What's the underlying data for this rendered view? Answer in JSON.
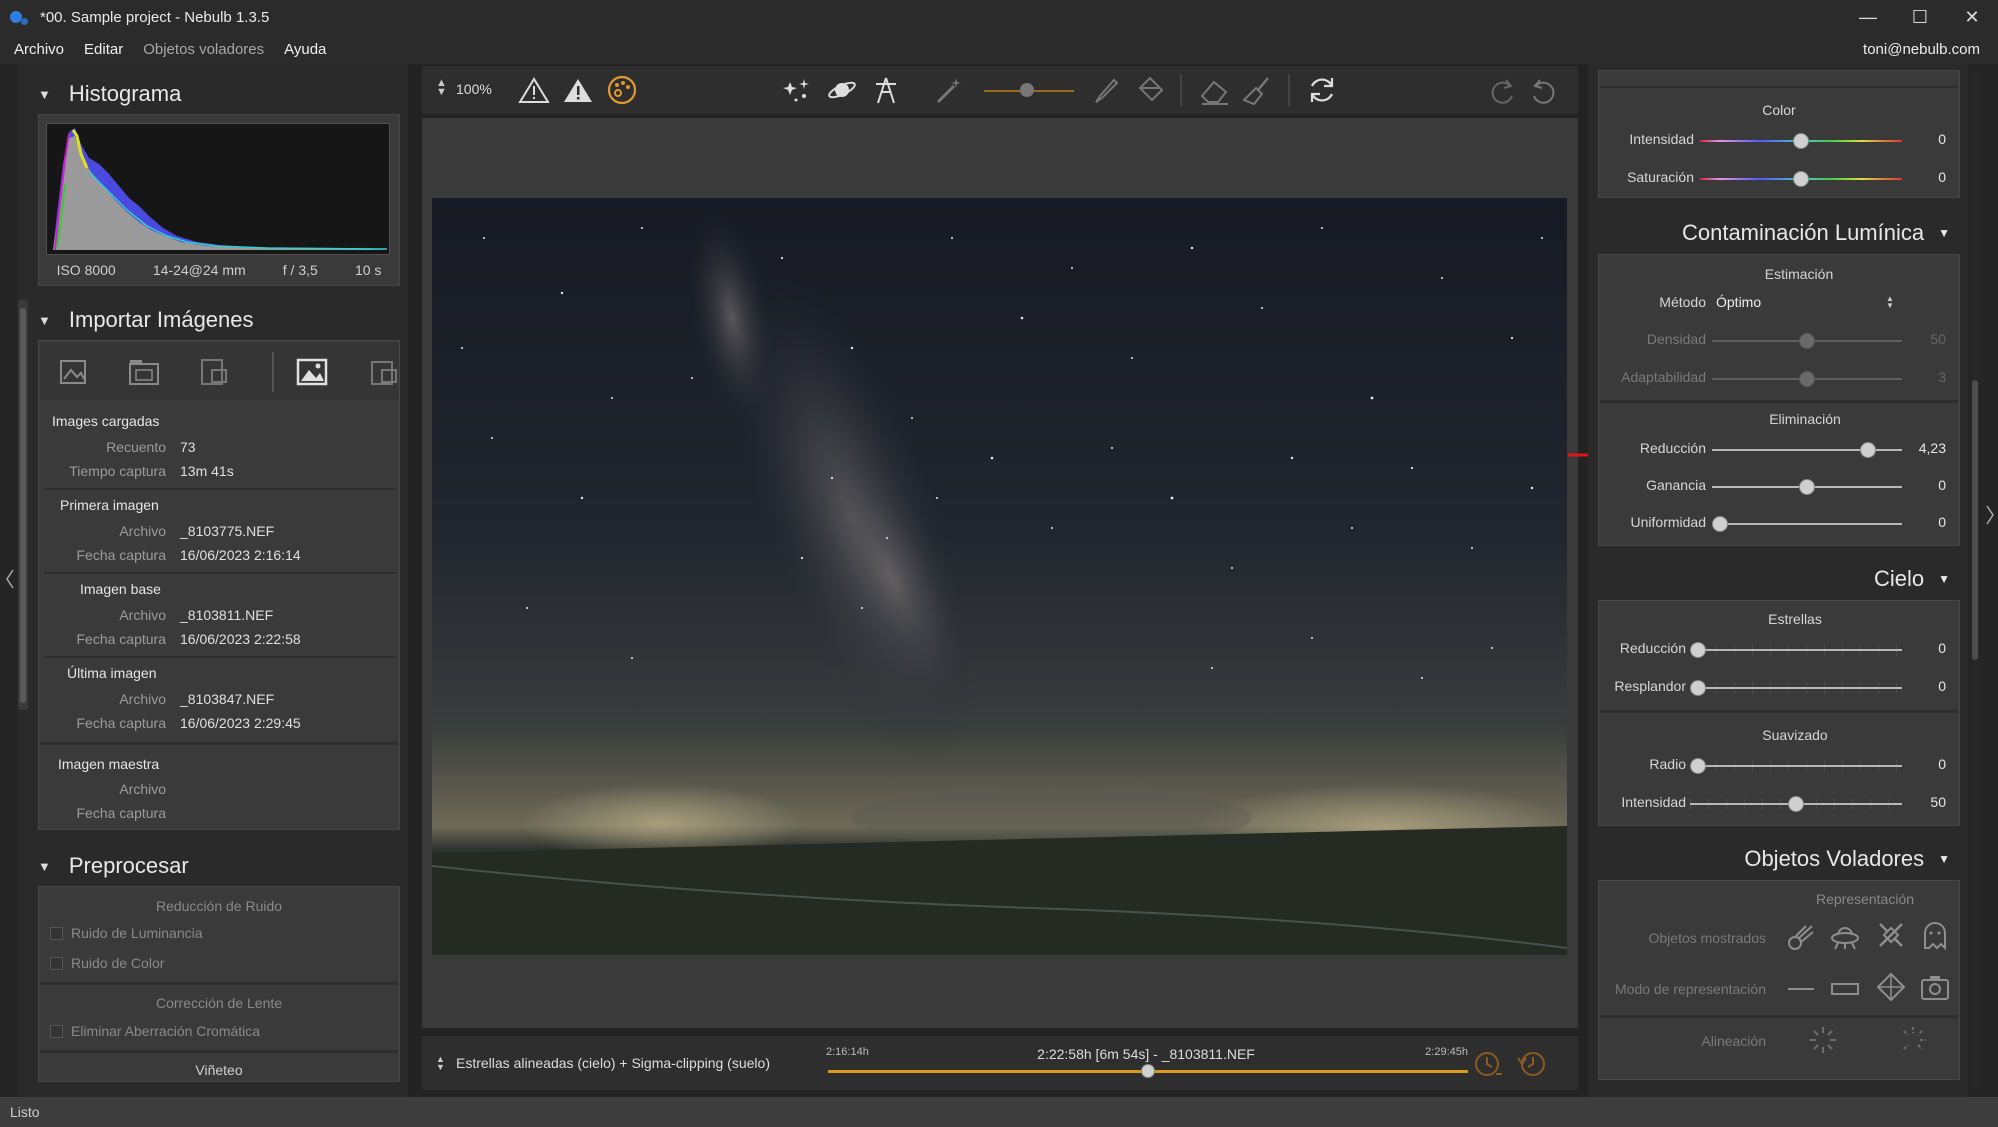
{
  "app": {
    "title": "*00. Sample project - Nebulb 1.3.5",
    "window_controls": {
      "minimize": "—",
      "maximize": "☐",
      "close": "✕"
    }
  },
  "menu": {
    "items": [
      "Archivo",
      "Editar",
      "Objetos voladores",
      "Ayuda"
    ],
    "user": "toni@nebulb.com"
  },
  "histogram": {
    "title": "Histograma",
    "iso": "ISO 8000",
    "lens": "14-24@24 mm",
    "aperture": "f / 3,5",
    "exposure": "10 s"
  },
  "import": {
    "title": "Importar Imágenes",
    "loaded": {
      "heading": "Images cargadas",
      "count_label": "Recuento",
      "count": "73",
      "time_label": "Tiempo captura",
      "time": "13m 41s"
    },
    "first": {
      "heading": "Primera imagen",
      "file_label": "Archivo",
      "file": "_8103775.NEF",
      "date_label": "Fecha captura",
      "date": "16/06/2023 2:16:14"
    },
    "base": {
      "heading": "Imagen base",
      "file_label": "Archivo",
      "file": "_8103811.NEF",
      "date_label": "Fecha captura",
      "date": "16/06/2023 2:22:58"
    },
    "last": {
      "heading": "Última imagen",
      "file_label": "Archivo",
      "file": "_8103847.NEF",
      "date_label": "Fecha captura",
      "date": "16/06/2023 2:29:45"
    },
    "master": {
      "heading": "Imagen maestra",
      "file_label": "Archivo",
      "date_label": "Fecha captura"
    }
  },
  "preprocess": {
    "title": "Preprocesar",
    "noise": {
      "heading": "Reducción de Ruido",
      "luminance": "Ruido de Luminancia",
      "color": "Ruido de Color"
    },
    "lens": {
      "heading": "Corrección de Lente",
      "aberration": "Eliminar Aberración Cromática"
    },
    "vignette": "Viñeteo"
  },
  "toolbar": {
    "zoom": "100%"
  },
  "bottom": {
    "mode": "Estrellas alineadas (cielo) + Sigma-clipping (suelo)",
    "start": "2:16:14h",
    "current": "2:22:58h [6m 54s] - _8103811.NEF",
    "end": "2:29:45h",
    "timeline_position": 0.5
  },
  "status": "Listo",
  "right": {
    "color": {
      "heading": "Color",
      "intensity": {
        "label": "Intensidad",
        "value": "0",
        "pos": 0.5
      },
      "saturation": {
        "label": "Saturación",
        "value": "0",
        "pos": 0.5
      }
    },
    "light_pollution": {
      "title": "Contaminación Lumínica",
      "estimation": "Estimación",
      "method_label": "Método",
      "method_value": "Óptimo",
      "density": {
        "label": "Densidad",
        "value": "50",
        "pos": 0.5
      },
      "adaptability": {
        "label": "Adaptabilidad",
        "value": "3",
        "pos": 0.5
      },
      "elimination": "Eliminación",
      "reduction": {
        "label": "Reducción",
        "value": "4,23",
        "pos": 0.82
      },
      "gain": {
        "label": "Ganancia",
        "value": "0",
        "pos": 0.5
      },
      "uniformity": {
        "label": "Uniformidad",
        "value": "0",
        "pos": 0.0
      }
    },
    "sky": {
      "title": "Cielo",
      "stars": "Estrellas",
      "reduction": {
        "label": "Reducción",
        "value": "0",
        "pos": 0.0
      },
      "glow": {
        "label": "Resplandor",
        "value": "0",
        "pos": 0.0
      },
      "smoothing": "Suavizado",
      "radius": {
        "label": "Radio",
        "value": "0",
        "pos": 0.0
      },
      "intensity": {
        "label": "Intensidad",
        "value": "50",
        "pos": 0.5
      }
    },
    "flying": {
      "title": "Objetos Voladores",
      "representation": "Representación",
      "shown": "Objetos mostrados",
      "mode": "Modo de representación",
      "alignment": "Alineación"
    }
  }
}
